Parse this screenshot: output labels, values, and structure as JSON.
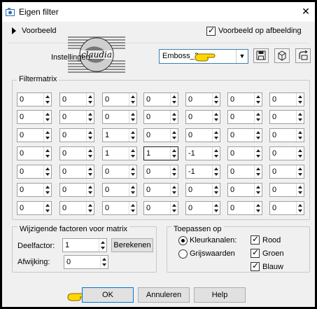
{
  "window": {
    "title": "Eigen filter",
    "close_label": "✕"
  },
  "preview": {
    "label": "Voorbeeld",
    "image_preview_label": "Voorbeeld op afbeelding",
    "image_preview_checked": true
  },
  "settings": {
    "label": "Instellingen:",
    "preset_value": "Emboss_3",
    "logo_text": "claudia"
  },
  "matrix": {
    "title": "Filtermatrix",
    "rows": [
      [
        "0",
        "0",
        "0",
        "0",
        "0",
        "0",
        "0"
      ],
      [
        "0",
        "0",
        "0",
        "0",
        "0",
        "0",
        "0"
      ],
      [
        "0",
        "0",
        "1",
        "0",
        "0",
        "0",
        "0"
      ],
      [
        "0",
        "0",
        "1",
        "1",
        "-1",
        "0",
        "0"
      ],
      [
        "0",
        "0",
        "0",
        "0",
        "-1",
        "0",
        "0"
      ],
      [
        "0",
        "0",
        "0",
        "0",
        "0",
        "0",
        "0"
      ],
      [
        "0",
        "0",
        "0",
        "0",
        "0",
        "0",
        "0"
      ]
    ]
  },
  "factors": {
    "title": "Wijzigende factoren voor matrix",
    "divisor_label": "Deelfactor:",
    "divisor_value": "1",
    "offset_label": "Afwijking:",
    "offset_value": "0",
    "compute_label": "Berekenen"
  },
  "apply": {
    "title": "Toepassen op",
    "color_channels_label": "Kleurkanalen:",
    "grayscale_label": "Grijswaarden",
    "red_label": "Rood",
    "green_label": "Groen",
    "blue_label": "Blauw"
  },
  "buttons": {
    "ok_label": "OK",
    "cancel_label": "Annuleren",
    "help_label": "Help"
  },
  "colors": {
    "focus_border": "#0078d7",
    "hand_pointer": "#ffd800"
  },
  "icons": [
    "app-icon",
    "close-icon",
    "expand-arrow-icon",
    "dropdown-arrow-icon",
    "save-preset-icon",
    "load-preset-icon",
    "reset-preset-icon",
    "pointing-hand-icon"
  ]
}
